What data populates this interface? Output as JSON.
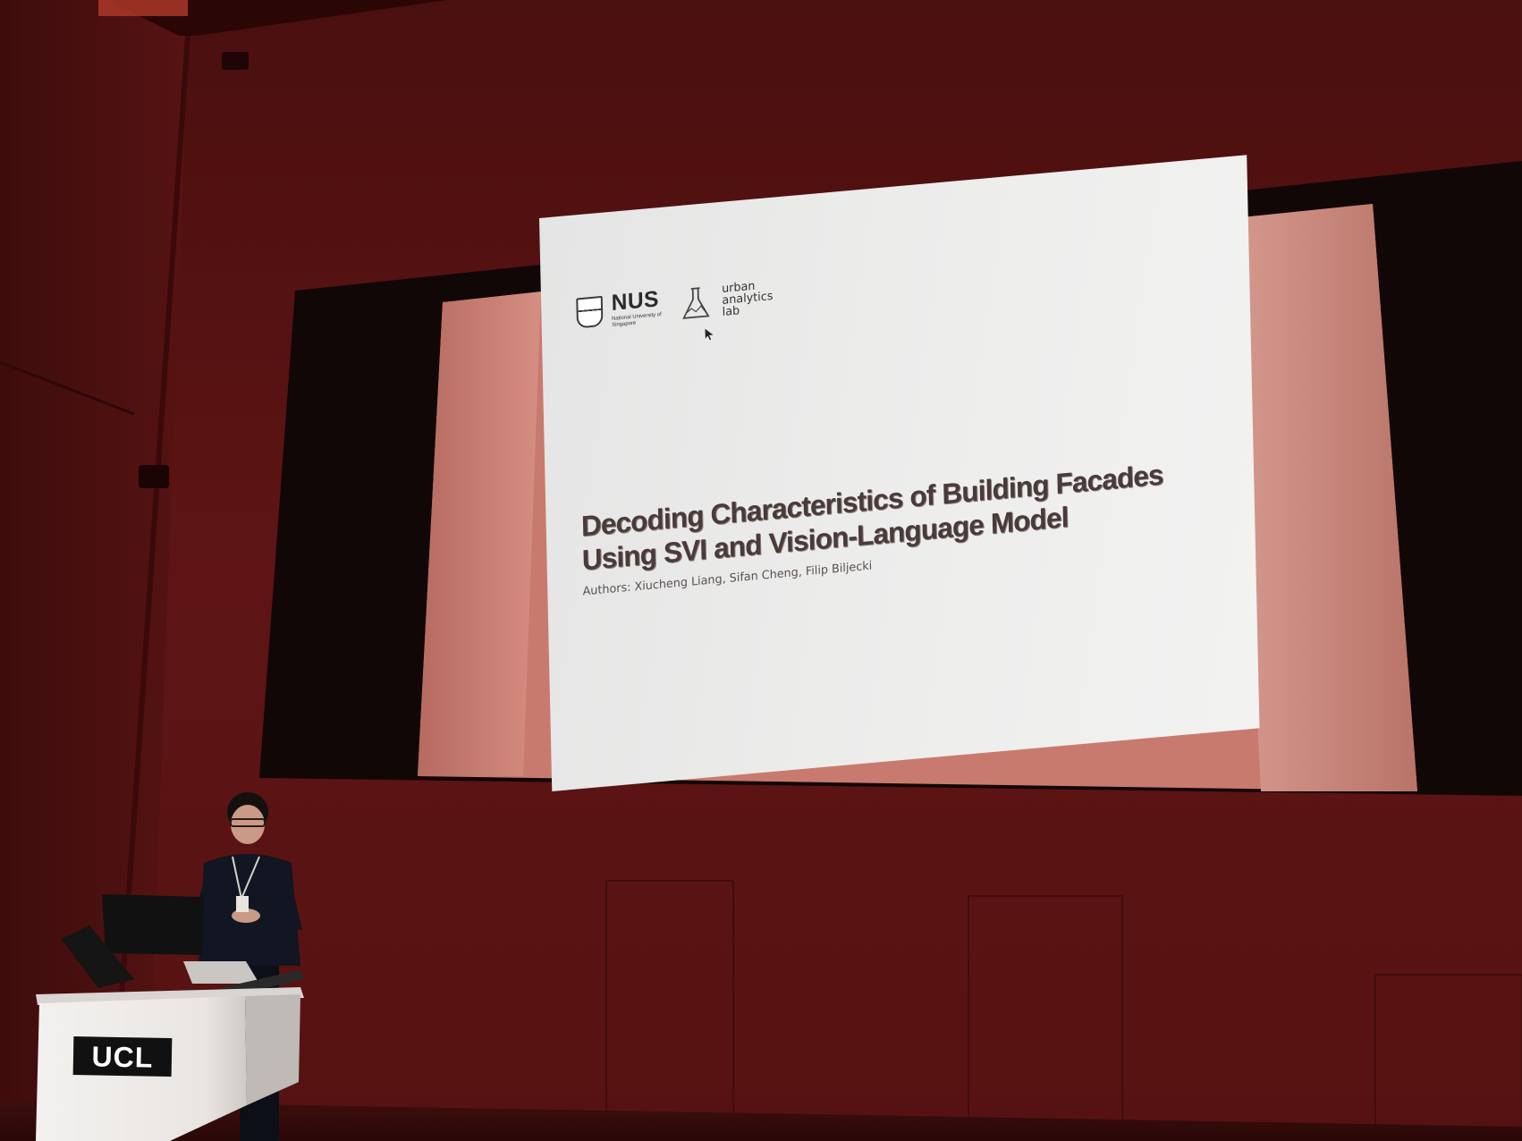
{
  "slide": {
    "logo_primary": "NUS",
    "logo_primary_sub": "National University of Singapore",
    "logo_secondary_lines": [
      "urban",
      "analytics",
      "lab"
    ],
    "title_lines": [
      "Decoding Characteristics of Building Facades",
      "Using SVI and Vision-Language Model"
    ],
    "authors": "Authors: Xiucheng Liang, Sifan Cheng, Filip Biljecki"
  },
  "podium": {
    "brand": "UCL"
  },
  "colors": {
    "wall": "#5a1212",
    "slide_background": "#ececeb",
    "title_text": "#4a3b3b",
    "podium": "#f1efed"
  }
}
